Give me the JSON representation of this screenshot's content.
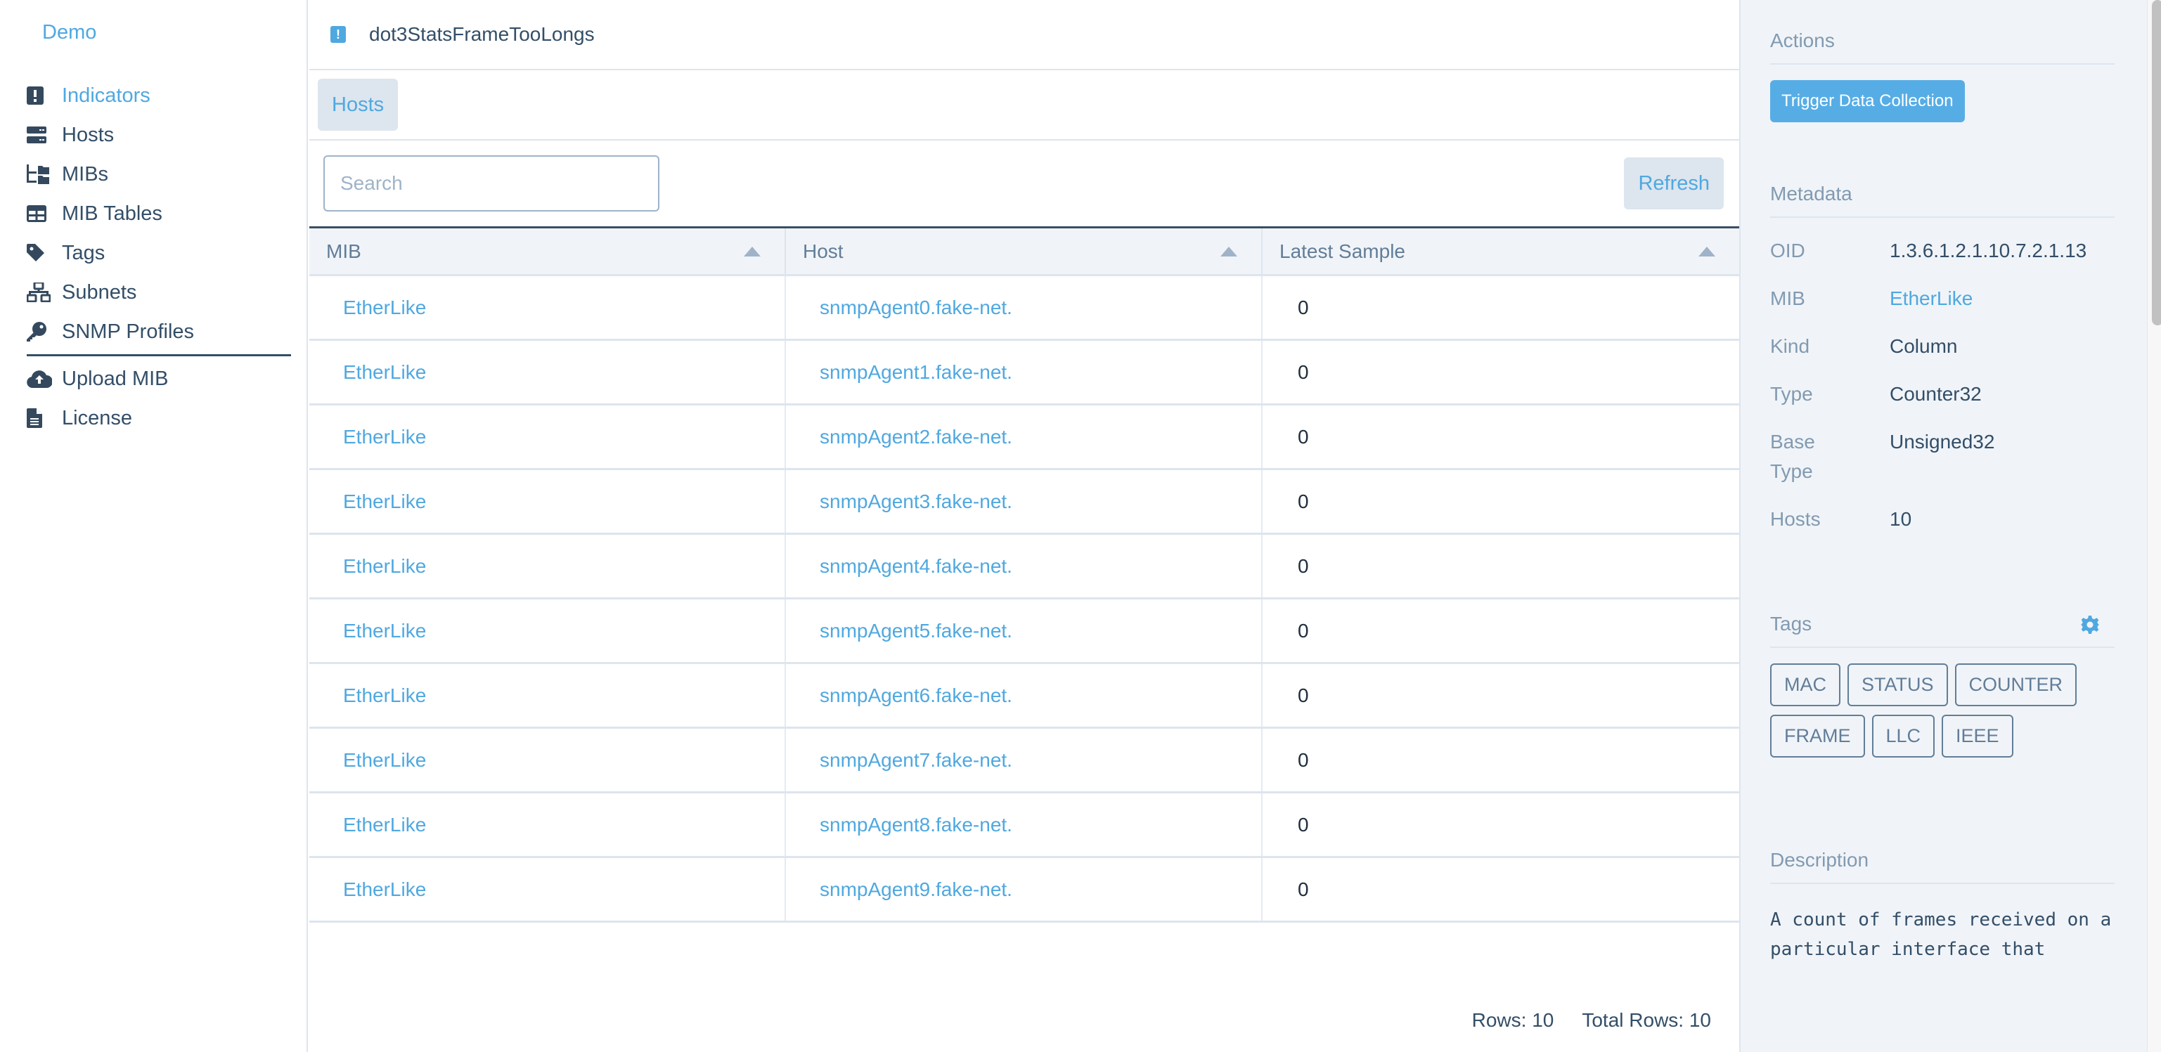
{
  "sidebar": {
    "brand": "Demo",
    "items": [
      {
        "label": "Indicators",
        "icon": "exclamation-square-icon",
        "active": true
      },
      {
        "label": "Hosts",
        "icon": "server-icon"
      },
      {
        "label": "MIBs",
        "icon": "folder-tree-icon"
      },
      {
        "label": "MIB Tables",
        "icon": "table-icon"
      },
      {
        "label": "Tags",
        "icon": "tag-icon"
      },
      {
        "label": "Subnets",
        "icon": "network-wired-icon"
      },
      {
        "label": "SNMP Profiles",
        "icon": "key-icon"
      }
    ],
    "secondary": [
      {
        "label": "Upload MIB",
        "icon": "cloud-upload-icon"
      },
      {
        "label": "License",
        "icon": "file-icon"
      }
    ]
  },
  "header": {
    "title": "dot3StatsFrameTooLongs",
    "icon": "exclamation-square-icon"
  },
  "tabs": [
    {
      "label": "Hosts",
      "active": true
    }
  ],
  "toolbar": {
    "search_placeholder": "Search",
    "search_value": "",
    "refresh_label": "Refresh"
  },
  "table": {
    "columns": [
      "MIB",
      "Host",
      "Latest Sample"
    ],
    "rows": [
      {
        "mib": "EtherLike",
        "host": "snmpAgent0.fake-net.",
        "sample": "0"
      },
      {
        "mib": "EtherLike",
        "host": "snmpAgent1.fake-net.",
        "sample": "0"
      },
      {
        "mib": "EtherLike",
        "host": "snmpAgent2.fake-net.",
        "sample": "0"
      },
      {
        "mib": "EtherLike",
        "host": "snmpAgent3.fake-net.",
        "sample": "0"
      },
      {
        "mib": "EtherLike",
        "host": "snmpAgent4.fake-net.",
        "sample": "0"
      },
      {
        "mib": "EtherLike",
        "host": "snmpAgent5.fake-net.",
        "sample": "0"
      },
      {
        "mib": "EtherLike",
        "host": "snmpAgent6.fake-net.",
        "sample": "0"
      },
      {
        "mib": "EtherLike",
        "host": "snmpAgent7.fake-net.",
        "sample": "0"
      },
      {
        "mib": "EtherLike",
        "host": "snmpAgent8.fake-net.",
        "sample": "0"
      },
      {
        "mib": "EtherLike",
        "host": "snmpAgent9.fake-net.",
        "sample": "0"
      }
    ],
    "footer": {
      "rows": "Rows: 10",
      "total_rows": "Total Rows: 10"
    }
  },
  "panel": {
    "actions": {
      "title": "Actions",
      "trigger_label": "Trigger Data Collection"
    },
    "metadata": {
      "title": "Metadata",
      "fields": [
        {
          "key": "OID",
          "value": "1.3.6.1.2.1.10.7.2.1.13"
        },
        {
          "key": "MIB",
          "value": "EtherLike",
          "link": true
        },
        {
          "key": "Kind",
          "value": "Column"
        },
        {
          "key": "Type",
          "value": "Counter32"
        },
        {
          "key": "Base Type",
          "value": "Unsigned32"
        },
        {
          "key": "Hosts",
          "value": "10"
        }
      ]
    },
    "tags": {
      "title": "Tags",
      "items": [
        "MAC",
        "STATUS",
        "COUNTER",
        "FRAME",
        "LLC",
        "IEEE"
      ]
    },
    "description": {
      "title": "Description",
      "text": "A count of frames received on a particular interface that"
    }
  },
  "colors": {
    "accent": "#4fa8e0",
    "text": "#334e68",
    "muted": "#829ab1",
    "panel_bg": "#f0f4f8",
    "button_bg": "#56ade6"
  }
}
